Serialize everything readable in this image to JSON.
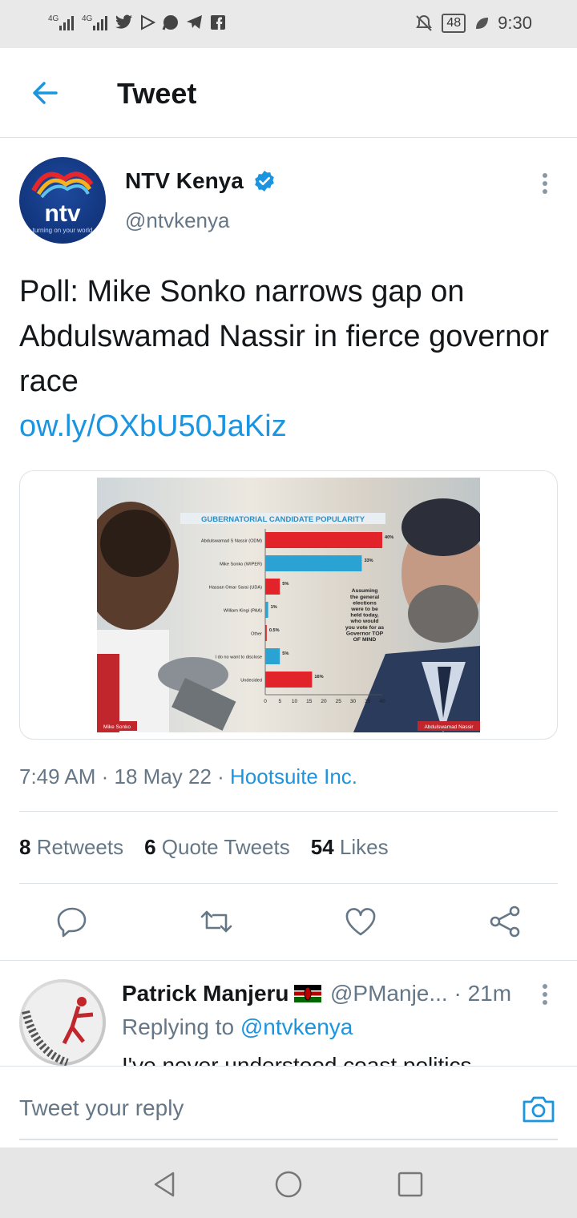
{
  "status_bar": {
    "left_text": "4G 4G",
    "battery": "48",
    "time": "9:30"
  },
  "header": {
    "title": "Tweet"
  },
  "tweet": {
    "author_name": "NTV Kenya",
    "author_handle": "@ntvkenya",
    "text": "Poll: Mike Sonko narrows gap on Abdulswamad Nassir in fierce governor race",
    "link": "ow.ly/OXbU50JaKiz",
    "time": "7:49 AM",
    "date": "18 May 22",
    "source": "Hootsuite Inc.",
    "avatar_logo": "ntv",
    "avatar_tagline": "turning on your world"
  },
  "image": {
    "chart_title": "GUBERNATORIAL CANDIDATE POPULARITY",
    "left_caption": "Mike Sonko",
    "right_caption": "Abdulswamad Nassir",
    "note": "Assuming the general elections were to be held today, who would you vote for as Governor TOP OF MIND",
    "chart_data": {
      "type": "bar",
      "title": "GUBERNATORIAL CANDIDATE POPULARITY",
      "categories": [
        "Abdulswamad S Nassir (ODM)",
        "Mike Sonko (WIPER)",
        "Hassan Omar Sarai (UDA)",
        "William Kingi (PAA)",
        "Other",
        "I do no want to disclose",
        "Undecided"
      ],
      "values": [
        40,
        33,
        5,
        1,
        0.5,
        5,
        16
      ],
      "value_labels": [
        "40%",
        "33%",
        "5%",
        "1%",
        "0.5%",
        "5%",
        "16%"
      ],
      "colors": [
        "#e3232a",
        "#2aa3d4",
        "#e3232a",
        "#2aa3d4",
        "#e3232a",
        "#2aa3d4",
        "#e3232a"
      ],
      "xlim": [
        0,
        40
      ],
      "xticks": [
        "0",
        "5",
        "10",
        "15",
        "20",
        "25",
        "30",
        "35",
        "40"
      ]
    }
  },
  "stats": {
    "retweets_count": "8",
    "retweets_label": "Retweets",
    "quotes_count": "6",
    "quotes_label": "Quote Tweets",
    "likes_count": "54",
    "likes_label": "Likes"
  },
  "reply": {
    "name": "Patrick Manjeru",
    "handle": "@PManje...",
    "age": "· 21m",
    "replying_prefix": "Replying to",
    "replying_handle": "@ntvkenya",
    "text": "I've never understood coast politics"
  },
  "compose": {
    "placeholder": "Tweet your reply"
  },
  "colors": {
    "accent": "#1b95e0",
    "muted": "#657786",
    "text": "#14171a"
  }
}
